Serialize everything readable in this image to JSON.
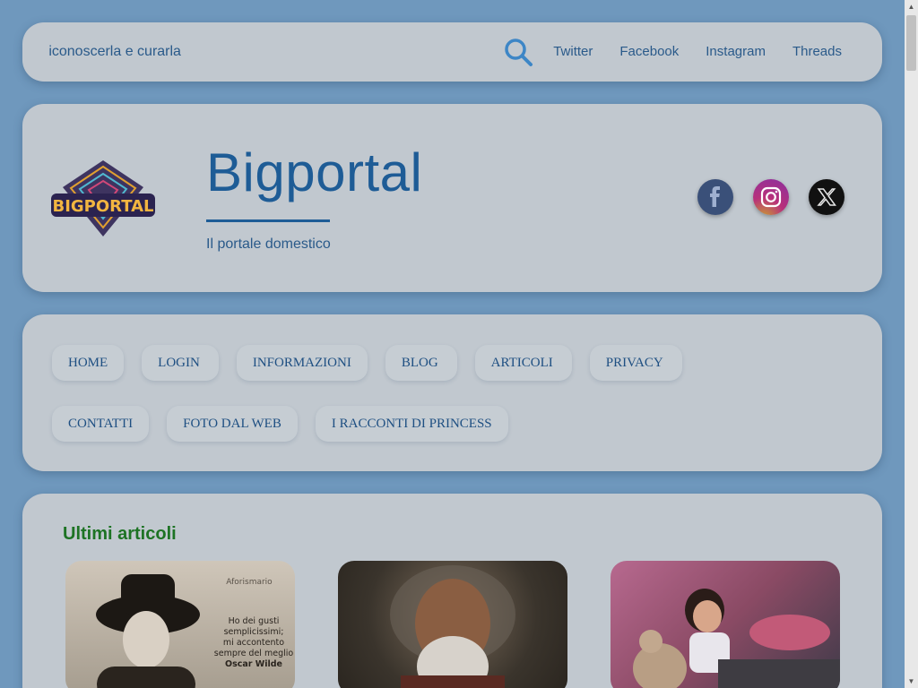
{
  "topbar": {
    "ticker_text": "riconoscerla e curarla",
    "links": [
      "Twitter",
      "Facebook",
      "Instagram",
      "Threads"
    ]
  },
  "header": {
    "site_title": "Bigportal",
    "tagline": "Il portale domestico",
    "logo_text": "BIGPORTAL",
    "socials": [
      {
        "icon": "facebook-icon",
        "color": "#3a5079"
      },
      {
        "icon": "instagram-icon",
        "color": "#b8307a"
      },
      {
        "icon": "x-twitter-icon",
        "color": "#111111"
      }
    ]
  },
  "nav": {
    "row1": [
      "HOME",
      "LOGIN",
      "INFORMAZIONI",
      "BLOG",
      "ARTICOLI",
      "PRIVACY"
    ],
    "row2": [
      "CONTATTI",
      "FOTO DAL WEB",
      "I RACCONTI DI PRINCESS"
    ],
    "caret": ""
  },
  "articles": {
    "title": "Ultimi articoli",
    "thumb1": {
      "label": "Aforismario",
      "quote": [
        "Ho dei gusti",
        "semplicissimi;",
        "mi accontento",
        "sempre del meglio"
      ],
      "author": "Oscar Wilde"
    }
  },
  "colors": {
    "background": "#6f98bd",
    "card": "#c1c8cf",
    "accent": "#1e5c96",
    "section_title": "#1d7324"
  }
}
